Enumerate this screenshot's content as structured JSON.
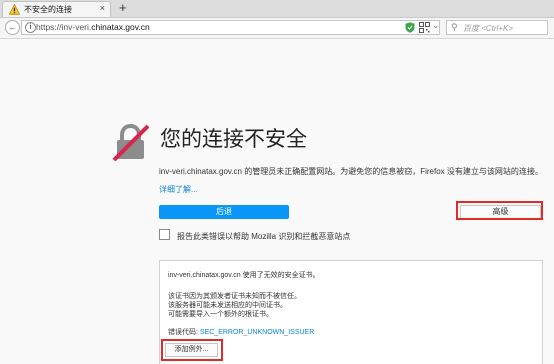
{
  "browser": {
    "tab_title": "不安全的连接",
    "tab_close": "×",
    "new_tab": "+",
    "url_prefix": "https://inv-veri.",
    "url_domain": "chinatax.gov.cn",
    "search_placeholder": "百度 <Ctrl+K>"
  },
  "error_page": {
    "title": "您的连接不安全",
    "description": "inv-veri.chinatax.gov.cn 的管理员未正确配置网站。为避免您的信息被窃，Firefox 没有建立与该网站的连接。",
    "learn_more": "详细了解...",
    "back_button": "后退",
    "advanced_button": "高级",
    "report_label": "报告此类错误以帮助 Mozilla 识别和拦截恶意站点",
    "advanced_panel": {
      "line1": "inv-veri.chinatax.gov.cn 使用了无效的安全证书。",
      "line2": "该证书因为其颁发者证书未知而不被信任。",
      "line3": "该服务器可能未发送相应的中间证书。",
      "line4": "可能需要导入一个额外的根证书。",
      "error_code_label": "错误代码:",
      "error_code": "SEC_ERROR_UNKNOWN_ISSUER",
      "add_exception_button": "添加例外..."
    }
  },
  "colors": {
    "primary_button": "#0996f8",
    "link": "#0a84d6",
    "highlight": "#e02b2b"
  }
}
